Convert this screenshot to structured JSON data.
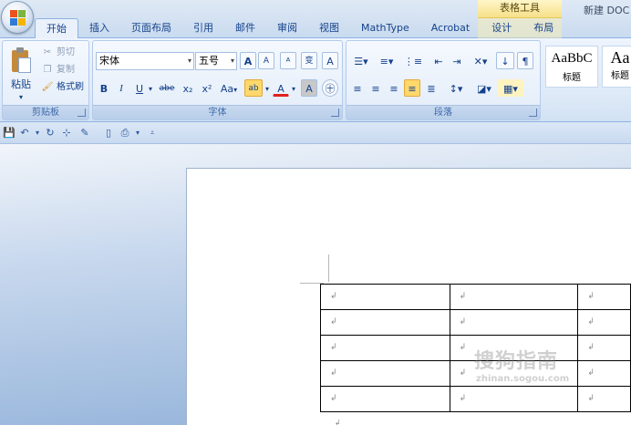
{
  "app": {
    "document_title": "新建 DOC"
  },
  "tabs": [
    {
      "label": "开始",
      "active": true
    },
    {
      "label": "插入"
    },
    {
      "label": "页面布局"
    },
    {
      "label": "引用"
    },
    {
      "label": "邮件"
    },
    {
      "label": "审阅"
    },
    {
      "label": "视图"
    },
    {
      "label": "MathType"
    },
    {
      "label": "Acrobat"
    },
    {
      "label": "设计"
    },
    {
      "label": "布局"
    }
  ],
  "context_tab_group": "表格工具",
  "ribbon": {
    "clipboard": {
      "label": "剪贴板",
      "paste": "粘贴",
      "cut": "剪切",
      "copy": "复制",
      "format_painter": "格式刷"
    },
    "font": {
      "label": "字体",
      "font_name": "宋体",
      "font_size": "五号",
      "grow_font": "A",
      "shrink_font": "A",
      "bold": "B",
      "italic": "I",
      "underline": "U",
      "strikethrough": "abe",
      "subscript": "x₂",
      "superscript": "x²",
      "change_case": "Aa",
      "font_color": "A",
      "char_shading": "A",
      "char_border": "A"
    },
    "paragraph": {
      "label": "段落"
    },
    "styles": {
      "sample_text": "AaBbC",
      "sample_text_2": "Aa",
      "style_name": "标题",
      "style_name_2": "标题"
    }
  },
  "document": {
    "table": {
      "rows": [
        [
          "↲",
          "↲",
          "↲"
        ],
        [
          "↲",
          "↲",
          "↲"
        ],
        [
          "↲",
          "↲",
          "↲"
        ],
        [
          "↲",
          "↲",
          "↲"
        ],
        [
          "↲",
          "↲",
          "↲"
        ]
      ]
    },
    "para_mark": "↲"
  },
  "watermark": {
    "line1": "搜狗指南",
    "line2": "zhinan.sogou.com"
  },
  "colors": {
    "ribbon_bg": "#dde9f7",
    "tab_text": "#15428b",
    "context_tab": "#f6e08a",
    "highlight": "#ffd86b"
  }
}
